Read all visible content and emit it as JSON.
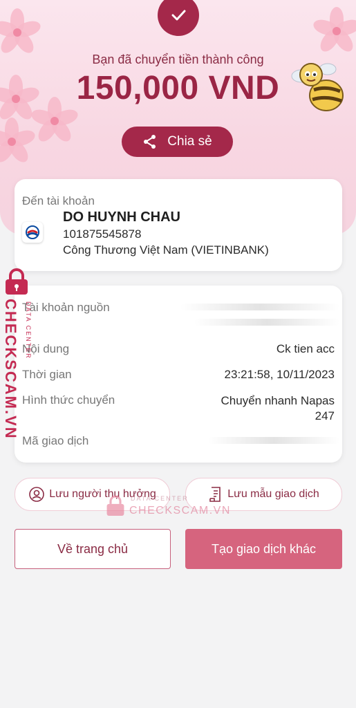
{
  "header": {
    "success_text": "Bạn đã chuyển tiền thành công",
    "amount": "150,000 VND",
    "share_label": "Chia sẻ"
  },
  "recipient": {
    "section_label": "Đến tài khoản",
    "name": "DO HUYNH CHAU",
    "account_number": "101875545878",
    "bank_name": "Công Thương Việt Nam (VIETINBANK)"
  },
  "details": {
    "source_label": "Tài khoản nguồn",
    "content_label": "Nội dung",
    "content_value": "Ck tien acc",
    "time_label": "Thời gian",
    "time_value": "23:21:58, 10/11/2023",
    "method_label": "Hình thức chuyển",
    "method_value_line1": "Chuyển nhanh Napas",
    "method_value_line2": "247",
    "txn_label": "Mã giao dịch"
  },
  "actions": {
    "save_recipient": "Lưu người thụ hưởng",
    "save_template": "Lưu mẫu giao dịch",
    "home": "Về trang chủ",
    "new_transaction": "Tạo giao dịch khác"
  },
  "watermark": {
    "brand": "CHECKSCAM.VN",
    "sub": "DATA CENTER"
  },
  "colors": {
    "brand": "#a4284a",
    "accent": "#d6647e"
  }
}
